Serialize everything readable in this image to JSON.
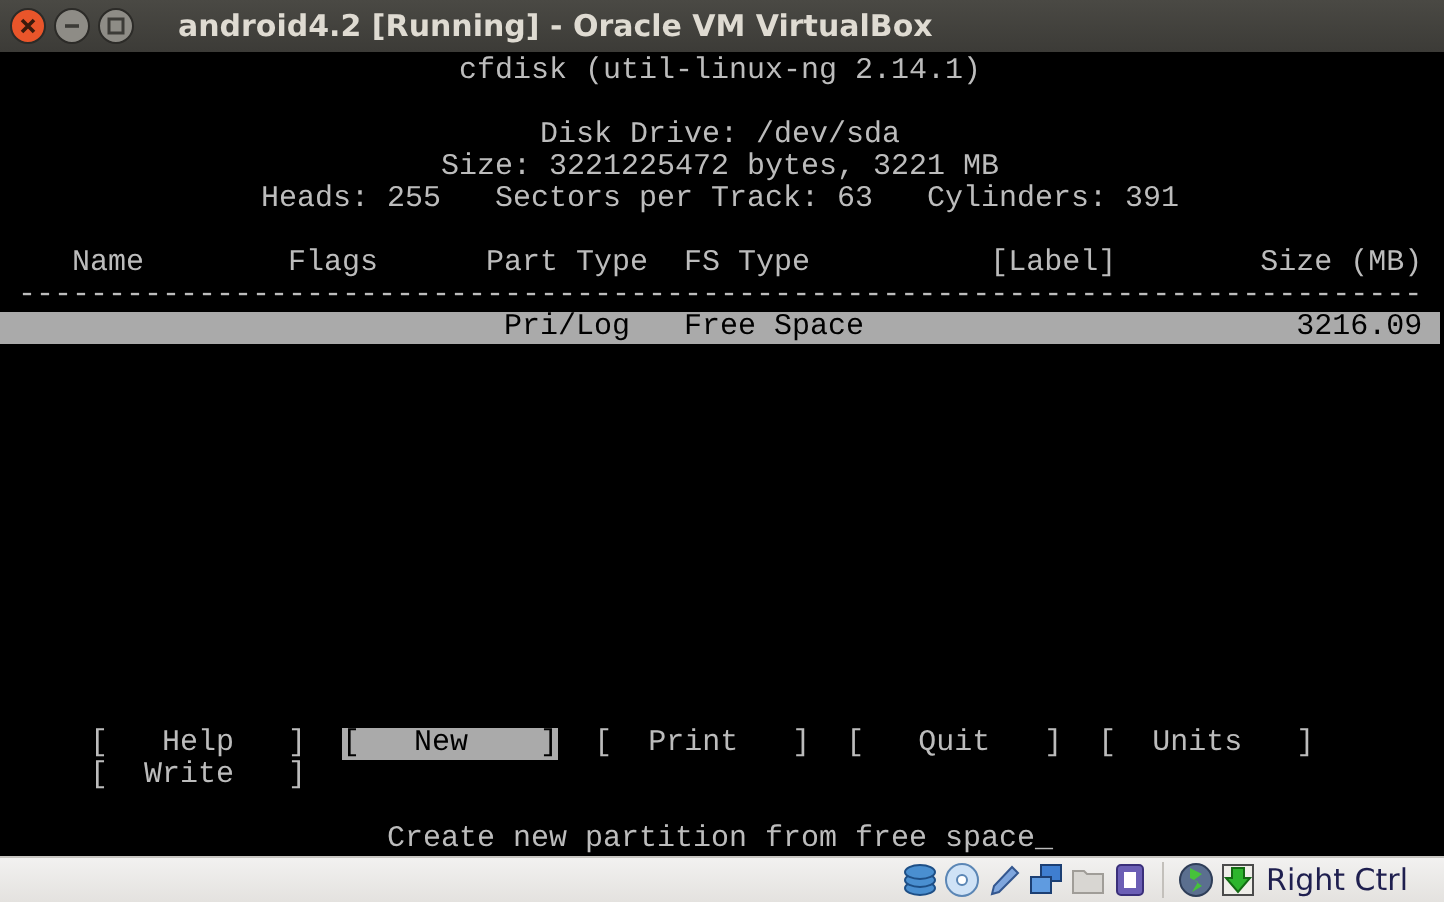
{
  "window": {
    "title": "android4.2 [Running] - Oracle VM VirtualBox"
  },
  "terminal": {
    "heading": "cfdisk (util-linux-ng 2.14.1)",
    "disk_info": [
      "Disk Drive: /dev/sda",
      "Size: 3221225472 bytes, 3221 MB",
      "Heads: 255   Sectors per Track: 63   Cylinders: 391"
    ],
    "table": {
      "columns": [
        "Name",
        "Flags",
        "Part Type",
        "FS Type",
        "[Label]",
        "Size (MB)"
      ],
      "separator": "------------------------------------------------------------------------------",
      "rows": [
        {
          "part_type": "Pri/Log",
          "fs_type": "Free Space",
          "size": "3216.09",
          "selected": true
        }
      ]
    },
    "menu": [
      {
        "label": "[   Help   ]",
        "selected": false
      },
      {
        "label": "[   New    ]",
        "selected": true
      },
      {
        "label": "[  Print   ]",
        "selected": false
      },
      {
        "label": "[   Quit   ]",
        "selected": false
      },
      {
        "label": "[  Units   ]",
        "selected": false
      },
      {
        "label": "[  Write   ]",
        "selected": false
      }
    ],
    "message": "Create new partition from free space",
    "cursor": "_"
  },
  "status_bar": {
    "host_key": "Right Ctrl"
  }
}
